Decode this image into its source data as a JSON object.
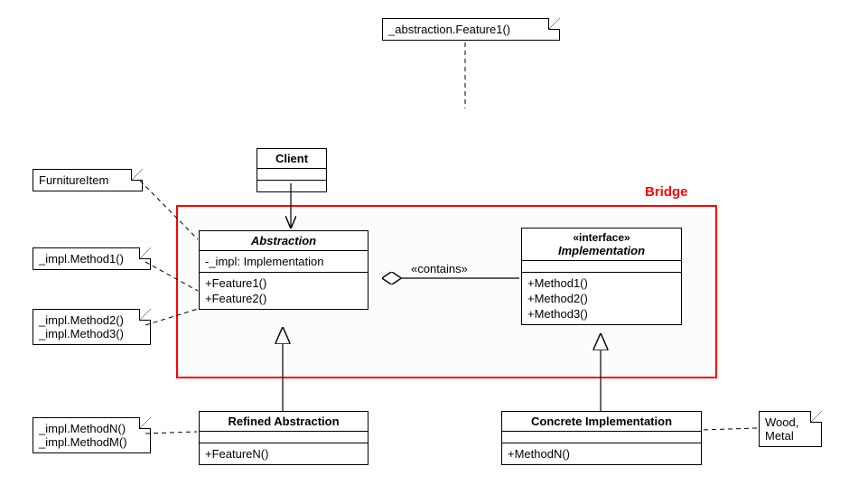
{
  "notes": {
    "top": "_abstraction.Feature1()",
    "furniture": "FurnitureItem",
    "n1": "_impl.Method1()",
    "n23a": "_impl.Method2()",
    "n23b": "_impl.Method3()",
    "nma": "_impl.MethodN()",
    "nmb": "_impl.MethodM()",
    "mat1": "Wood,",
    "mat2": "Metal"
  },
  "client": {
    "title": "Client"
  },
  "bridge": {
    "label": "Bridge",
    "contains": "«contains»"
  },
  "abstraction": {
    "title": "Abstraction",
    "field": "-_impl: Implementation",
    "m1": "+Feature1()",
    "m2": "+Feature2()"
  },
  "implementation": {
    "stereo": "«interface»",
    "title": "Implementation",
    "m1": "+Method1()",
    "m2": "+Method2()",
    "m3": "+Method3()"
  },
  "refined": {
    "title": "Refined Abstraction",
    "m1": "+FeatureN()"
  },
  "concrete": {
    "title": "Concrete Implementation",
    "m1": "+MethodN()"
  }
}
